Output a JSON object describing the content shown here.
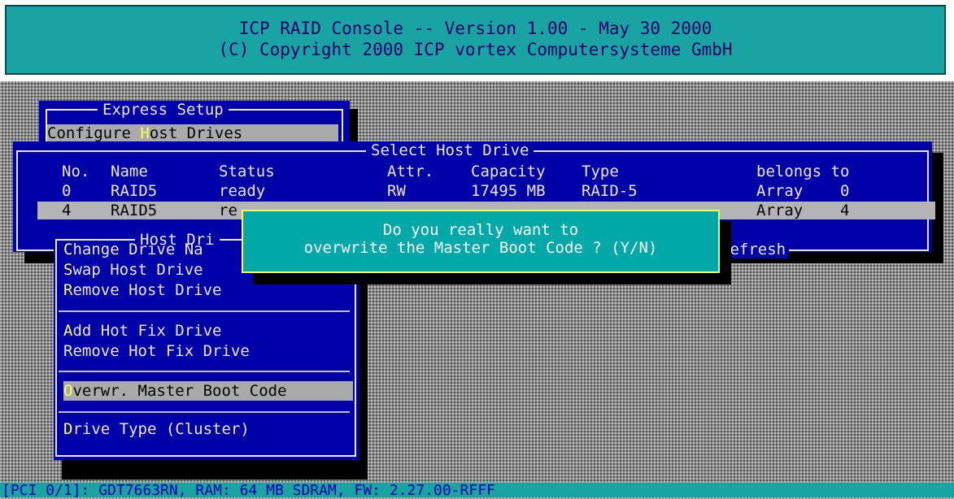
{
  "header": {
    "line1": "ICP RAID Console -- Version 1.00 - May 30 2000",
    "line2": "(C) Copyright 2000 ICP vortex Computersysteme GmbH"
  },
  "express_setup": {
    "title": "Express Setup",
    "item_pre": "Configure ",
    "item_hotkey": "H",
    "item_post": "ost Drives"
  },
  "select_host_drive": {
    "title": "Select Host Drive",
    "columns": [
      "No.",
      "Name",
      "Status",
      "Attr.",
      "Capacity",
      "Type",
      "belongs to"
    ],
    "rows": [
      {
        "no": "0",
        "name": "RAID5",
        "status": "ready",
        "attr": "RW",
        "capacity": "17495 MB",
        "type": "RAID-5",
        "belongs": "Array",
        "array_no": "0"
      },
      {
        "no": "4",
        "name": "RAID5",
        "status": "re",
        "attr": "",
        "capacity": "",
        "type": "",
        "belongs": "Array",
        "array_no": "4"
      }
    ],
    "bottom_frame_text": "Refresh"
  },
  "host_drive_menu": {
    "title": "Host Dri",
    "items": [
      {
        "hotkey": "C",
        "rest": "hange Drive Na"
      },
      {
        "hotkey": "S",
        "rest": "wap Host Drive"
      },
      {
        "hotkey": "R",
        "rest": "emove Host Drive"
      },
      {
        "hotkey": "A",
        "rest": "dd Hot Fix Drive"
      },
      {
        "hotkey": "",
        "rest": "Remove Hot Fix Drive"
      },
      {
        "hotkey": "O",
        "rest": "verwr. Master Boot Code"
      },
      {
        "hotkey": "D",
        "rest": "rive Type (Cluster)"
      }
    ]
  },
  "dialog": {
    "line1": "Do you really want to",
    "line2": "overwrite the Master Boot Code ? (Y/N)"
  },
  "status_bar": {
    "text": "[PCI 0/1]: GDT7663RN, RAM: 64 MB SDRAM, FW: 2.27.00-RFFF"
  },
  "colors": {
    "panel_blue": "#0000a8",
    "teal": "#1aa3a3",
    "hotkey_yellow": "#ffff55",
    "selection_gray": "#aaaaaa"
  }
}
